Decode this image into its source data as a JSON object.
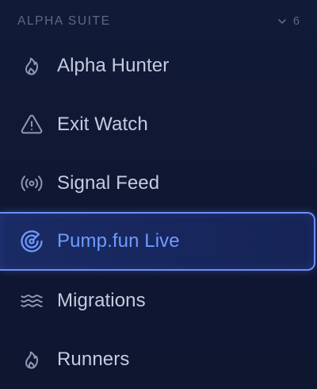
{
  "section": {
    "title": "ALPHA SUITE",
    "count": "6",
    "chevron_icon": "chevron-down-icon"
  },
  "items": [
    {
      "label": "Alpha Hunter",
      "icon": "flame-icon",
      "active": false
    },
    {
      "label": "Exit Watch",
      "icon": "warning-triangle-icon",
      "active": false
    },
    {
      "label": "Signal Feed",
      "icon": "broadcast-icon",
      "active": false
    },
    {
      "label": "Pump.fun Live",
      "icon": "radar-icon",
      "active": true
    },
    {
      "label": "Migrations",
      "icon": "waves-icon",
      "active": false
    },
    {
      "label": "Runners",
      "icon": "flame-icon",
      "active": false
    }
  ],
  "colors": {
    "background": "#0f1731",
    "muted_text": "#5c6a8a",
    "item_text": "#c4cce0",
    "active_text": "#6e9bff",
    "active_border": "#6f8ff0",
    "active_bg": "#1a2a64"
  }
}
